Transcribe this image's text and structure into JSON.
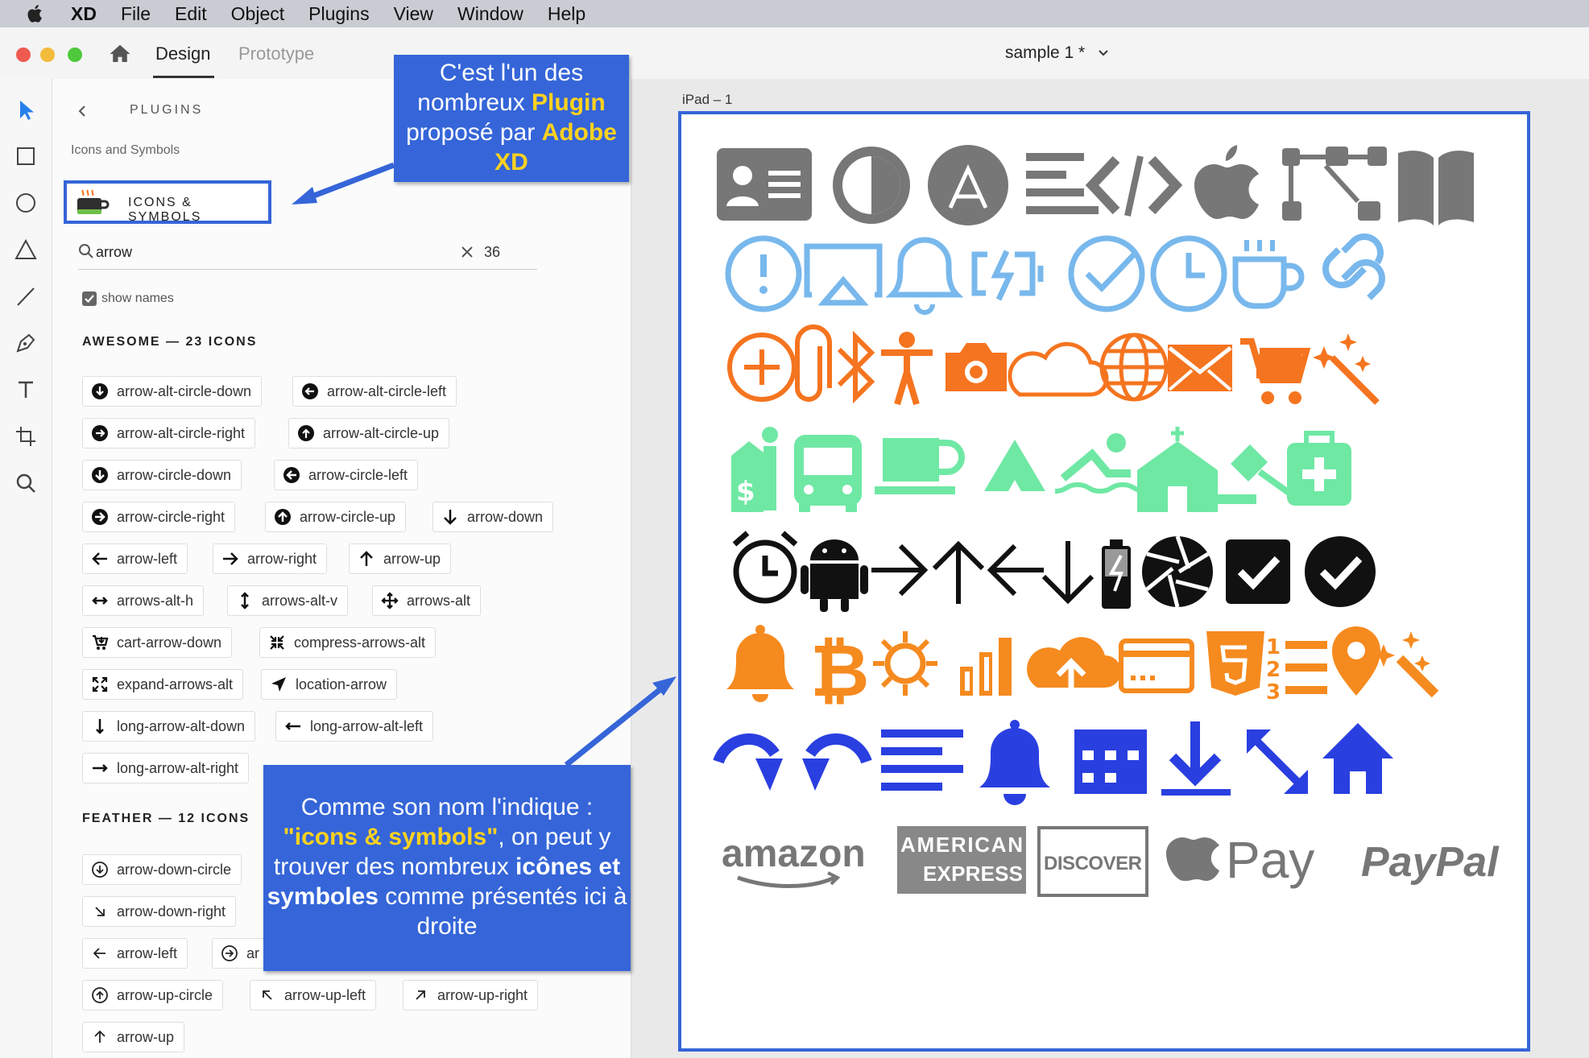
{
  "menubar": {
    "app": "XD",
    "items": [
      "File",
      "Edit",
      "Object",
      "Plugins",
      "View",
      "Window",
      "Help"
    ]
  },
  "titlebar": {
    "tab_design": "Design",
    "tab_prototype": "Prototype",
    "document_title": "sample 1 *"
  },
  "panel": {
    "title": "PLUGINS",
    "subtitle": "Icons and Symbols",
    "plugin_name": "ICONS & SYMBOLS",
    "search_value": "arrow",
    "icon_size": "36",
    "show_names_label": "show names",
    "show_names_checked": true,
    "awesome_title": "AWESOME — 23 ICONS",
    "feather_title": "FEATHER — 12 ICONS",
    "awesome_icons": [
      "arrow-alt-circle-down",
      "arrow-alt-circle-left",
      "arrow-alt-circle-right",
      "arrow-alt-circle-up",
      "arrow-circle-down",
      "arrow-circle-left",
      "arrow-circle-right",
      "arrow-circle-up",
      "arrow-down",
      "arrow-left",
      "arrow-right",
      "arrow-up",
      "arrows-alt-h",
      "arrows-alt-v",
      "arrows-alt",
      "cart-arrow-down",
      "compress-arrows-alt",
      "expand-arrows-alt",
      "location-arrow",
      "long-arrow-alt-down",
      "long-arrow-alt-left",
      "long-arrow-alt-right"
    ],
    "feather_icons": [
      "arrow-down-circle",
      "arrow-down-right",
      "arrow-left",
      "arrow-up-circle",
      "arrow-up-left",
      "arrow-up-right",
      "arrow-up"
    ],
    "feather_partial": "ar"
  },
  "canvas": {
    "artboard_label": "iPad – 1",
    "brand_text": {
      "amazon": "amazon",
      "amex_top": "AMERICAN",
      "amex_bottom": "EXPRESS",
      "discover": "DISCOVER",
      "applepay": "Pay",
      "paypal": "PayPal"
    },
    "colors": {
      "gray": "#777777",
      "light_blue": "#78b8ec",
      "orange": "#f5741f",
      "green": "#6fe8a4",
      "black": "#111111",
      "amber": "#f58a1f",
      "blue": "#2a3fe0"
    }
  },
  "callouts": {
    "c1_part1": "C'est l'un des nombreux ",
    "c1_highlight1": "Plugin",
    "c1_part2": " proposé par ",
    "c1_highlight2": "Adobe XD",
    "c2_part1": "Comme son nom l'indique : ",
    "c2_highlight": "\"icons & symbols\"",
    "c2_part2": ", on peut y trouver des nombreux ",
    "c2_bold": "icônes et symboles",
    "c2_part3": " comme présentés ici à droite"
  },
  "accent_color": "#3565d8"
}
